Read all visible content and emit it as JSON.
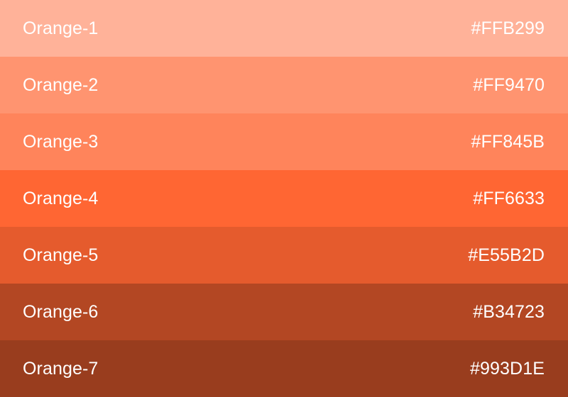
{
  "palette": {
    "swatches": [
      {
        "name": "Orange-1",
        "hex": "#FFB299",
        "color": "#FFB299"
      },
      {
        "name": "Orange-2",
        "hex": "#FF9470",
        "color": "#FF9470"
      },
      {
        "name": "Orange-3",
        "hex": "#FF845B",
        "color": "#FF845B"
      },
      {
        "name": "Orange-4",
        "hex": "#FF6633",
        "color": "#FF6633"
      },
      {
        "name": "Orange-5",
        "hex": "#E55B2D",
        "color": "#E55B2D"
      },
      {
        "name": "Orange-6",
        "hex": "#B34723",
        "color": "#B34723"
      },
      {
        "name": "Orange-7",
        "hex": "#993D1E",
        "color": "#993D1E"
      }
    ]
  }
}
